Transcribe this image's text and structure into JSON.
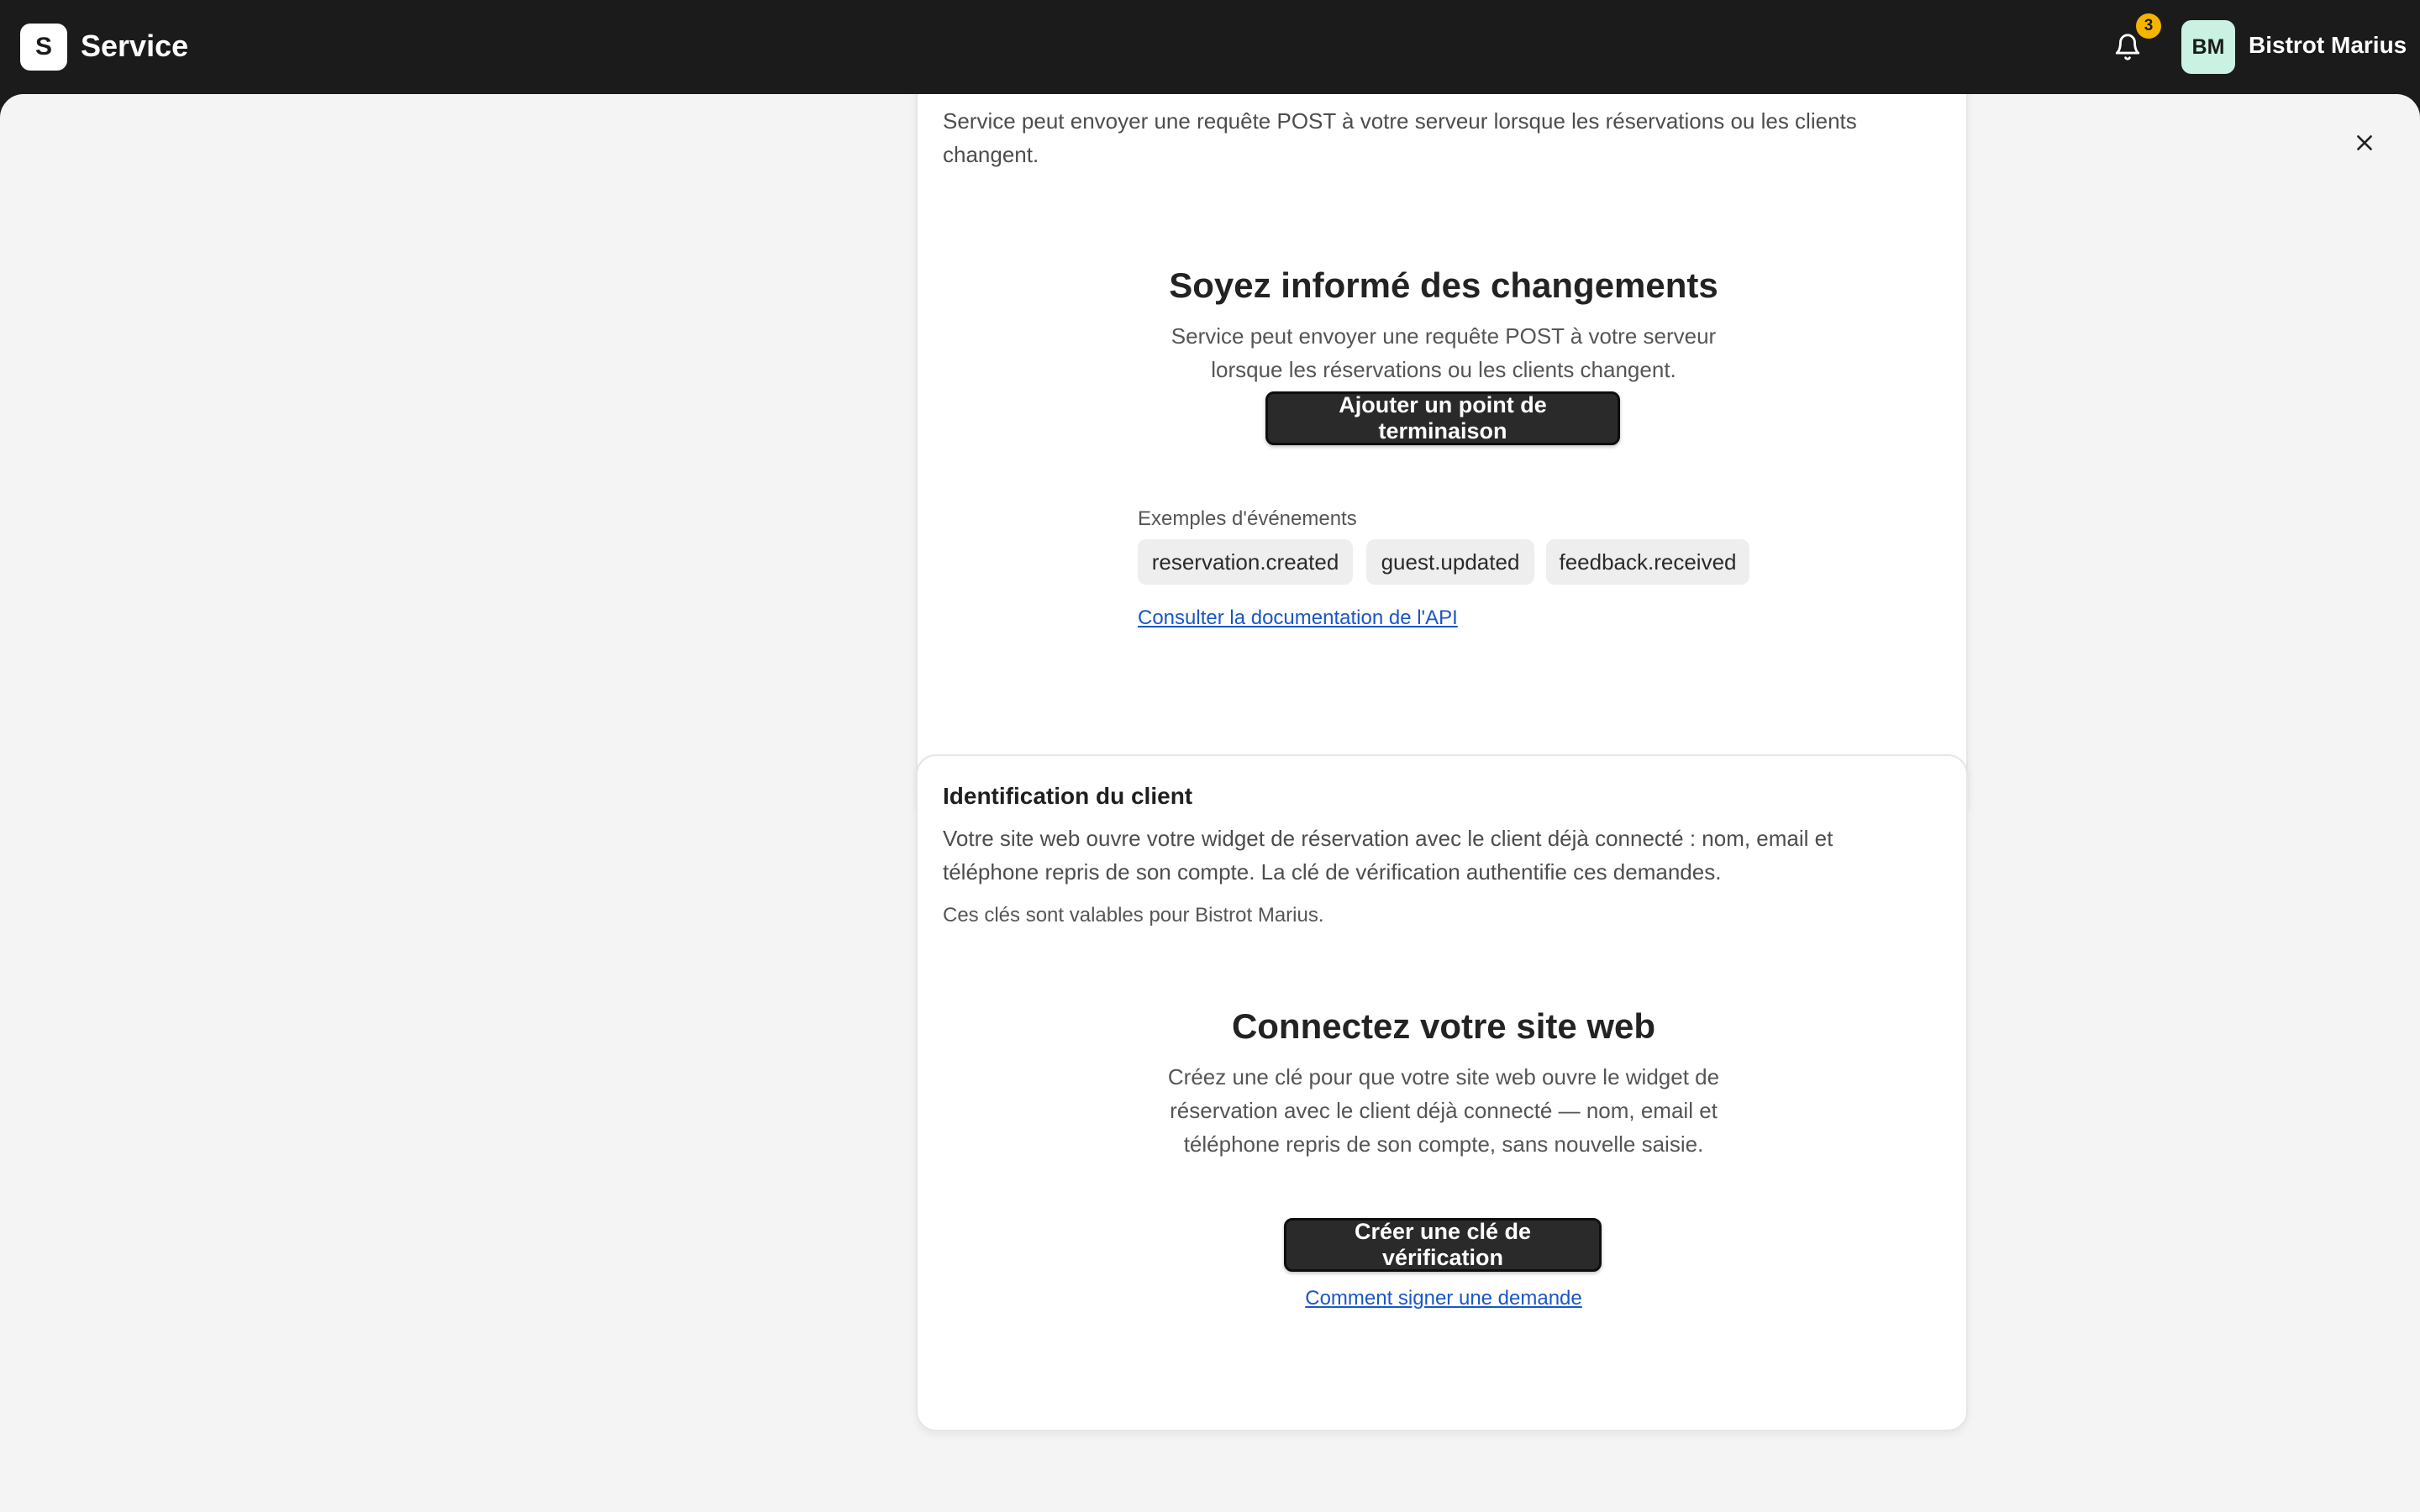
{
  "header": {
    "logo_letter": "S",
    "app_name": "Service",
    "notifications_count": "3",
    "avatar_initials": "BM",
    "org_name": "Bistrot Marius"
  },
  "webhooks_card": {
    "intro": "Service peut envoyer une requête POST à votre serveur lorsque les réservations ou les clients changent.",
    "empty_title": "Soyez informé des changements",
    "empty_desc": "Service peut envoyer une requête POST à votre serveur lorsque les réservations ou les clients changent.",
    "add_button": "Ajouter un point de terminaison",
    "events_label": "Exemples d'événements",
    "events": [
      "reservation.created",
      "guest.updated",
      "feedback.received"
    ],
    "docs_link": "Consulter la documentation de l'API"
  },
  "identity_card": {
    "title": "Identification du client",
    "desc": "Votre site web ouvre votre widget de réservation avec le client déjà connecté : nom, email et téléphone repris de son compte. La clé de vérification authentifie ces demandes.",
    "note": "Ces clés sont valables pour Bistrot Marius.",
    "empty_title": "Connectez votre site web",
    "empty_desc": "Créez une clé pour que votre site web ouvre le widget de réservation avec le client déjà connecté — nom, email et téléphone repris de son compte, sans nouvelle saisie.",
    "create_button": "Créer une clé de vérification",
    "sign_link": "Comment signer une demande"
  },
  "colors": {
    "topbar": "#1b1b1b",
    "badge": "#f5b400",
    "avatar": "#c9f2e3",
    "link": "#1a56c7"
  }
}
